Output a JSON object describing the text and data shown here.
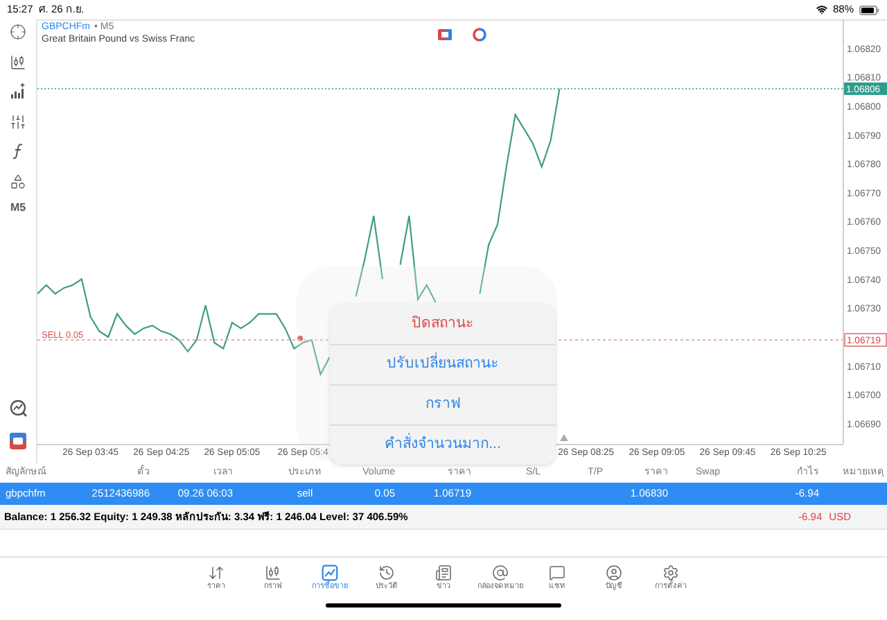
{
  "status_bar": {
    "time": "15:27",
    "date": "ศ. 26 ก.ย.",
    "battery": "88%"
  },
  "left_toolbar": {
    "timeframe": "M5"
  },
  "chart": {
    "symbol": "GBPCHFm",
    "timeframe": "• M5",
    "description": "Great Britain Pound vs Swiss Franc",
    "current_price": "1.06806",
    "position": {
      "label": "SELL 0.05",
      "price": "1.06719"
    },
    "chart_data": {
      "type": "line",
      "ylim": [
        1.06683,
        1.0683
      ],
      "categories": [
        null,
        null,
        null,
        null,
        null,
        null,
        "26 Sep 03:45",
        null,
        null,
        null,
        null,
        null,
        null,
        null,
        "26 Sep 04:25",
        null,
        null,
        null,
        null,
        null,
        null,
        null,
        "26 Sep 05:05",
        null,
        null,
        null,
        null,
        null,
        null,
        null,
        "26 Sep 05:4",
        null,
        null,
        null,
        null,
        null,
        null,
        null,
        null,
        null,
        null,
        null,
        null,
        null,
        null,
        null,
        null,
        null,
        null,
        null,
        null,
        null,
        null,
        null,
        null,
        null,
        null,
        null,
        null,
        null,
        null,
        null,
        "26 Sep 08:25",
        null,
        null,
        null,
        null,
        null,
        null,
        null,
        "26 Sep 09:05",
        null,
        null,
        null,
        null,
        null,
        null,
        null,
        "26 Sep 09:45",
        null,
        null,
        null,
        null,
        null,
        null,
        null,
        "26 Sep 10:25",
        null,
        null,
        null,
        null
      ],
      "series": [
        {
          "color": "#3f9f77",
          "values": [
            1.06735,
            1.06738,
            1.06735,
            1.06737,
            1.06738,
            1.0674,
            1.06727,
            1.06722,
            1.0672,
            1.06728,
            1.06724,
            1.06721,
            1.06723,
            1.06724,
            1.06722,
            1.06721,
            1.06719,
            1.06715,
            1.06719,
            1.06731,
            1.06718,
            1.06716,
            1.06725,
            1.06723,
            1.06725,
            1.06728,
            1.06728,
            1.06728,
            1.06723,
            1.06716,
            1.06718,
            1.06719,
            1.06707,
            1.06713,
            null,
            null,
            1.06734,
            1.06747,
            1.06762,
            1.0674,
            null,
            1.06745,
            1.06762,
            1.06733,
            1.06738,
            1.06732,
            null,
            null,
            null,
            null,
            1.06735,
            1.06752,
            1.06759,
            1.06779,
            1.06797,
            1.06792,
            1.06787,
            1.06779,
            1.06788,
            1.06806,
            null,
            null,
            null,
            null,
            null,
            null,
            null,
            null,
            null,
            null,
            null,
            null,
            null,
            null,
            null,
            null,
            null,
            null,
            null,
            null,
            null,
            null,
            null,
            null,
            null,
            null,
            null,
            null,
            null,
            null,
            null
          ]
        }
      ],
      "yticks": [
        {
          "value": 1.0682,
          "label": "1.06820"
        },
        {
          "value": 1.0681,
          "label": "1.06810"
        },
        {
          "value": 1.068,
          "label": "1.06800"
        },
        {
          "value": 1.0679,
          "label": "1.06790"
        },
        {
          "value": 1.0678,
          "label": "1.06780"
        },
        {
          "value": 1.0677,
          "label": "1.06770"
        },
        {
          "value": 1.0676,
          "label": "1.06760"
        },
        {
          "value": 1.0675,
          "label": "1.06750"
        },
        {
          "value": 1.0674,
          "label": "1.06740"
        },
        {
          "value": 1.0673,
          "label": "1.06730"
        },
        {
          "value": 1.0671,
          "label": "1.06710"
        },
        {
          "value": 1.067,
          "label": "1.06700"
        },
        {
          "value": 1.0669,
          "label": "1.06690"
        }
      ]
    }
  },
  "context_menu": [
    {
      "label": "ปิดสถานะ",
      "kind": "destructive"
    },
    {
      "label": "ปรับเปลี่ยนสถานะ",
      "kind": "action"
    },
    {
      "label": "กราฟ",
      "kind": "action"
    },
    {
      "label": "คำสั่งจำนวนมาก...",
      "kind": "action"
    }
  ],
  "positions_table": {
    "columns": [
      "สัญลักษณ์",
      "ตั๋ว",
      "เวลา",
      "ประเภท",
      "Volume",
      "ราคา",
      "S/L",
      "T/P",
      "ราคา",
      "Swap",
      "กำไร",
      "หมายเหตุ"
    ],
    "rows": [
      {
        "symbol": "gbpchfm",
        "ticket": "2512436986",
        "time": "09.26 06:03",
        "type": "sell",
        "volume": "0.05",
        "open_price": "1.06719",
        "current_price": "1.06830",
        "profit": "-6.94",
        "selected": true
      }
    ]
  },
  "summary": {
    "text": "Balance: 1 256.32 Equity: 1 249.38 หลักประกัน: 3.34 ฟรี: 1 246.04 Level: 37 406.59%",
    "profit": "-6.94",
    "currency": "USD"
  },
  "bottom_tabs": [
    {
      "label": "ราคา",
      "selected": false
    },
    {
      "label": "กราฟ",
      "selected": false
    },
    {
      "label": "การซื้อขาย",
      "selected": true
    },
    {
      "label": "ประวัติ",
      "selected": false
    },
    {
      "label": "ข่าว",
      "selected": false
    },
    {
      "label": "กล่องจดหมาย",
      "selected": false
    },
    {
      "label": "แชท",
      "selected": false
    },
    {
      "label": "บัญชี",
      "selected": false
    },
    {
      "label": "การตั้งค่า",
      "selected": false
    }
  ]
}
